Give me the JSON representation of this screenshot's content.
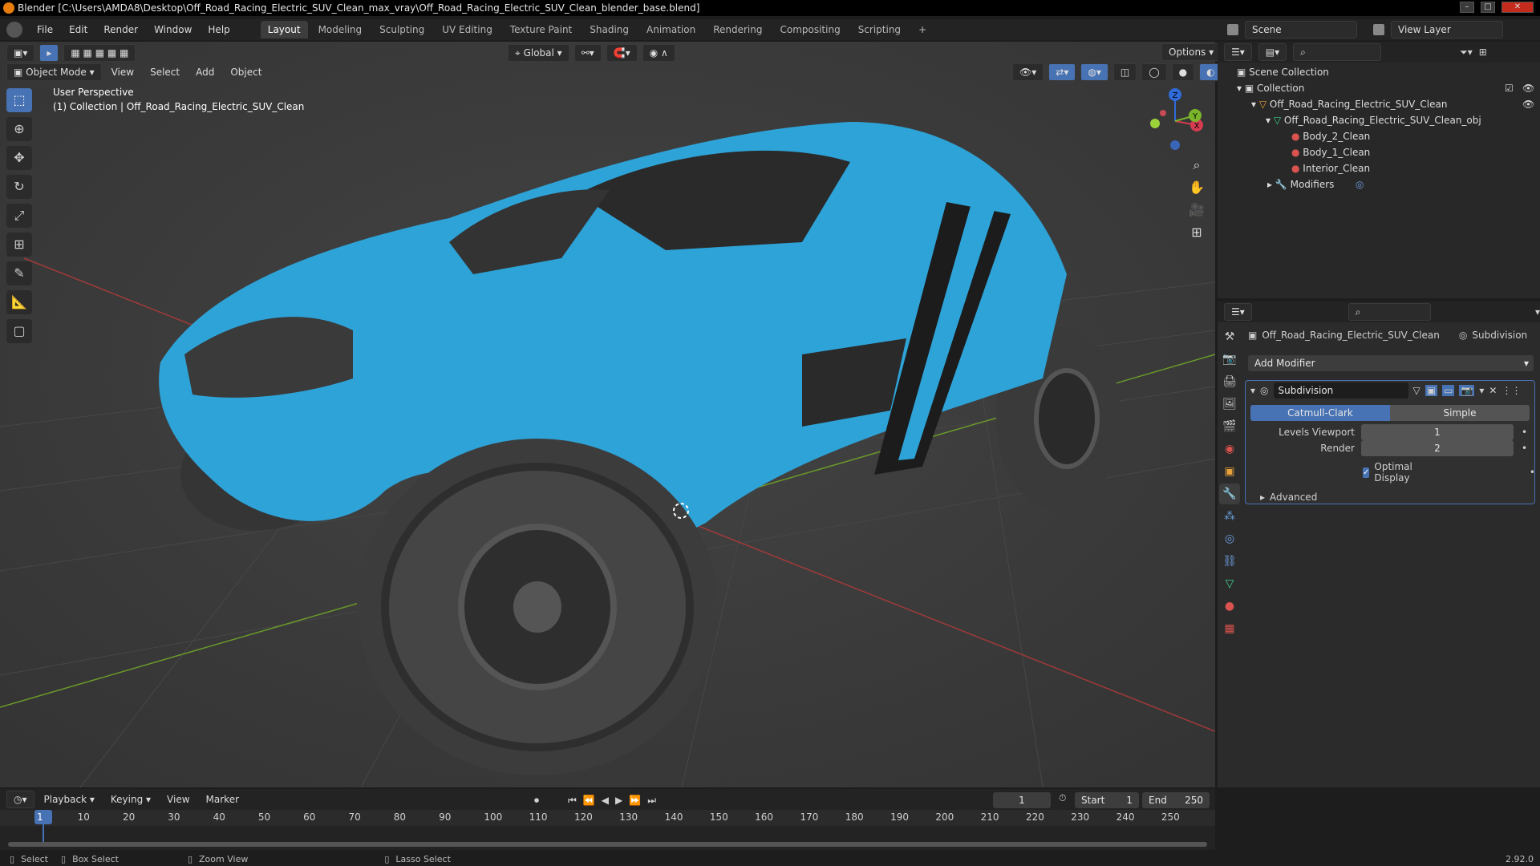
{
  "window": {
    "title": "Blender [C:\\Users\\AMDA8\\Desktop\\Off_Road_Racing_Electric_SUV_Clean_max_vray\\Off_Road_Racing_Electric_SUV_Clean_blender_base.blend]"
  },
  "menubar": {
    "items": [
      "File",
      "Edit",
      "Render",
      "Window",
      "Help"
    ]
  },
  "workspaces": {
    "tabs": [
      "Layout",
      "Modeling",
      "Sculpting",
      "UV Editing",
      "Texture Paint",
      "Shading",
      "Animation",
      "Rendering",
      "Compositing",
      "Scripting"
    ],
    "active": "Layout",
    "add_label": "+"
  },
  "scene": {
    "label": "Scene",
    "view_layer": "View Layer"
  },
  "viewport": {
    "transform_orientation": "Global",
    "options_label": "Options",
    "mode": "Object Mode",
    "menus": [
      "View",
      "Select",
      "Add",
      "Object"
    ],
    "perspective_label": "User Perspective",
    "collection_label": "(1) Collection | Off_Road_Racing_Electric_SUV_Clean",
    "gizmo": {
      "x": "X",
      "y": "Y",
      "z": "Z"
    }
  },
  "outliner": {
    "scene_collection": "Scene Collection",
    "collection": "Collection",
    "object": "Off_Road_Racing_Electric_SUV_Clean",
    "mesh": "Off_Road_Racing_Electric_SUV_Clean_obj",
    "materials": [
      "Body_2_Clean",
      "Body_1_Clean",
      "Interior_Clean"
    ],
    "modifiers": "Modifiers"
  },
  "properties": {
    "object_name": "Off_Road_Racing_Electric_SUV_Clean",
    "modifier_tab": "Subdivision",
    "add_modifier": "Add Modifier",
    "modifier_name": "Subdivision",
    "mode_catmull": "Catmull-Clark",
    "mode_simple": "Simple",
    "levels_viewport_label": "Levels Viewport",
    "levels_viewport_value": "1",
    "render_label": "Render",
    "render_value": "2",
    "optimal_display": "Optimal Display",
    "advanced": "Advanced"
  },
  "timeline": {
    "menus": [
      "Playback",
      "Keying",
      "View",
      "Marker"
    ],
    "current_frame": "1",
    "start_label": "Start",
    "start_value": "1",
    "end_label": "End",
    "end_value": "250",
    "ticks": [
      "1",
      "10",
      "20",
      "30",
      "40",
      "50",
      "60",
      "70",
      "80",
      "90",
      "100",
      "110",
      "120",
      "130",
      "140",
      "150",
      "160",
      "170",
      "180",
      "190",
      "200",
      "210",
      "220",
      "230",
      "240",
      "250"
    ]
  },
  "statusbar": {
    "select": "Select",
    "box_select": "Box Select",
    "zoom_view": "Zoom View",
    "lasso_select": "Lasso Select",
    "version": "2.92.0"
  },
  "colors": {
    "accent": "#4772b3",
    "car_body": "#2ea3d8",
    "grid": "#393939"
  }
}
